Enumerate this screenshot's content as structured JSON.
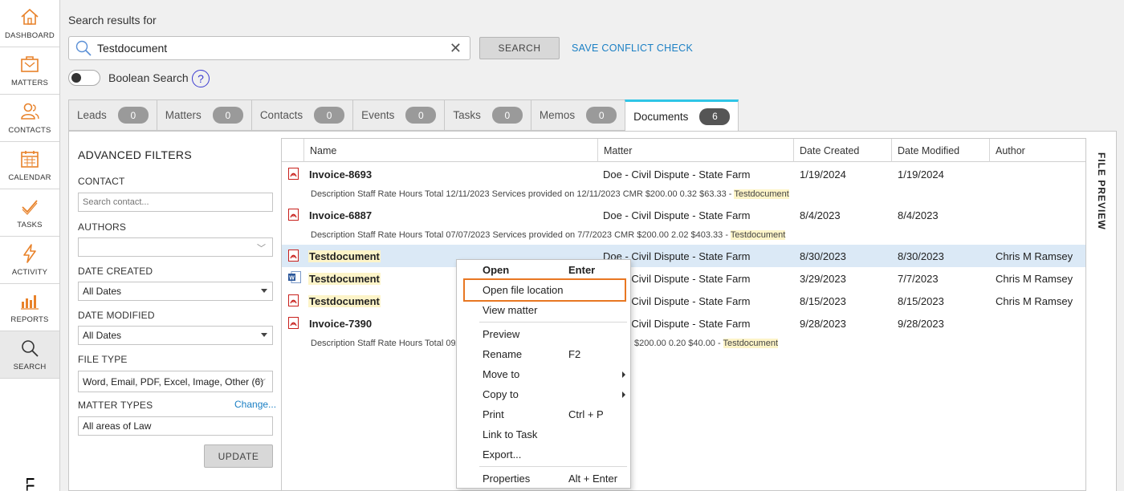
{
  "nav": {
    "items": [
      {
        "label": "DASHBOARD"
      },
      {
        "label": "MATTERS"
      },
      {
        "label": "CONTACTS"
      },
      {
        "label": "CALENDAR"
      },
      {
        "label": "TASKS"
      },
      {
        "label": "ACTIVITY"
      },
      {
        "label": "REPORTS"
      },
      {
        "label": "SEARCH"
      }
    ],
    "bottom_mark": "LL"
  },
  "search": {
    "heading": "Search results for",
    "value": "Testdocument",
    "clear": "✕",
    "button": "SEARCH",
    "conflict_link": "SAVE CONFLICT CHECK",
    "boolean_label": "Boolean Search",
    "help": "?"
  },
  "tabs": [
    {
      "label": "Leads",
      "count": "0"
    },
    {
      "label": "Matters",
      "count": "0"
    },
    {
      "label": "Contacts",
      "count": "0"
    },
    {
      "label": "Events",
      "count": "0"
    },
    {
      "label": "Tasks",
      "count": "0"
    },
    {
      "label": "Memos",
      "count": "0"
    },
    {
      "label": "Documents",
      "count": "6"
    }
  ],
  "filters": {
    "title": "ADVANCED FILTERS",
    "contact_label": "CONTACT",
    "contact_placeholder": "Search contact...",
    "authors_label": "AUTHORS",
    "authors_value": "",
    "date_created_label": "DATE CREATED",
    "date_created_value": "All Dates",
    "date_modified_label": "DATE MODIFIED",
    "date_modified_value": "All Dates",
    "file_type_label": "FILE TYPE",
    "file_type_value": "Word, Email, PDF, Excel, Image, Other (6)",
    "matter_types_label": "MATTER TYPES",
    "change_link": "Change...",
    "matter_types_value": "All areas of Law",
    "update_button": "UPDATE"
  },
  "table": {
    "columns": [
      "Name",
      "Matter",
      "Date Created",
      "Date Modified",
      "Author"
    ],
    "rows": [
      {
        "icon": "pdf-icon",
        "name": "Invoice-8693",
        "matter": "Doe - Civil Dispute - State Farm",
        "created": "1/19/2024",
        "modified": "1/19/2024",
        "author": "",
        "desc": "Description Staff Rate Hours Total 12/11/2023 Services provided on 12/11/2023 CMR $200.00 0.32 $63.33 - ",
        "desc_hl": "Testdocument"
      },
      {
        "icon": "pdf-icon",
        "name": "Invoice-6887",
        "matter": "Doe - Civil Dispute - State Farm",
        "created": "8/4/2023",
        "modified": "8/4/2023",
        "author": "",
        "desc": "Description Staff Rate Hours Total 07/07/2023 Services provided on 7/7/2023 CMR $200.00 2.02 $403.33 - ",
        "desc_hl": "Testdocument"
      },
      {
        "icon": "pdf-icon",
        "name": "Testdocument",
        "matter": "Doe - Civil Dispute - State Farm",
        "created": "8/30/2023",
        "modified": "8/30/2023",
        "author": "Chris M Ramsey"
      },
      {
        "icon": "word-icon",
        "name": "Testdocument",
        "matter": "Doe - Civil Dispute - State Farm",
        "created": "3/29/2023",
        "modified": "7/7/2023",
        "author": "Chris M Ramsey"
      },
      {
        "icon": "pdf-icon",
        "name": "Testdocument",
        "matter": "Doe - Civil Dispute - State Farm",
        "created": "8/15/2023",
        "modified": "8/15/2023",
        "author": "Chris M Ramsey"
      },
      {
        "icon": "pdf-icon",
        "name": "Invoice-7390",
        "matter": "Doe - Civil Dispute - State Farm",
        "created": "9/28/2023",
        "modified": "9/28/2023",
        "author": "",
        "desc": "Description Staff Rate Hours Total 09/",
        "desc_tail": "$200.00 0.20 $40.00 - ",
        "desc_hl": "Testdocument"
      }
    ]
  },
  "preview": {
    "label": "FILE PREVIEW"
  },
  "context_menu": {
    "items": [
      {
        "label": "Open",
        "shortcut": "Enter"
      },
      {
        "label": "Open file location",
        "shortcut": ""
      },
      {
        "label": "View matter",
        "shortcut": ""
      },
      {
        "label": "Preview",
        "shortcut": ""
      },
      {
        "label": "Rename",
        "shortcut": "F2"
      },
      {
        "label": "Move to",
        "shortcut": ""
      },
      {
        "label": "Copy to",
        "shortcut": ""
      },
      {
        "label": "Print",
        "shortcut": "Ctrl + P"
      },
      {
        "label": "Link to Task",
        "shortcut": ""
      },
      {
        "label": "Export...",
        "shortcut": ""
      },
      {
        "label": "Properties",
        "shortcut": "Alt + Enter"
      }
    ]
  },
  "colors": {
    "accent": "#e8822a",
    "link": "#1a7fc4",
    "tab_active": "#2fc5e6",
    "highlight": "#fdf4c8",
    "selected_row": "#dbe9f6"
  }
}
